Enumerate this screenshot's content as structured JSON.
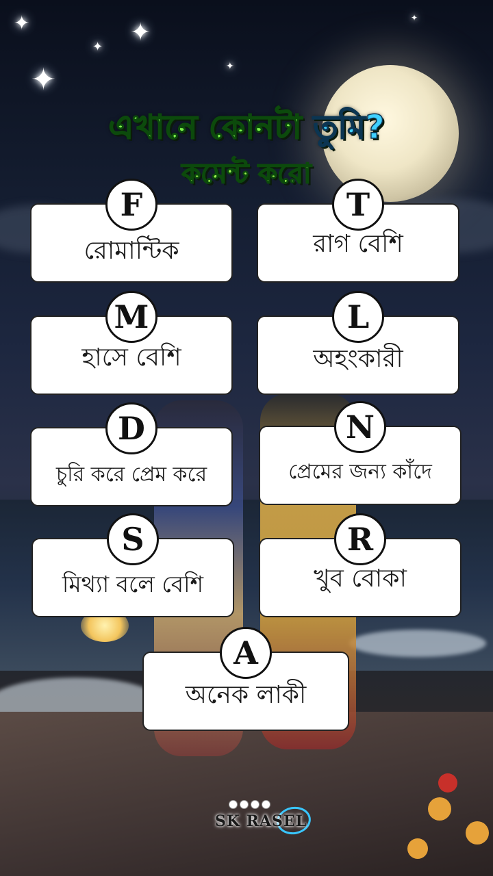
{
  "title": {
    "line1_part1": "এখানে কোনটা ",
    "line1_part2": "তুমি?",
    "line2": "কমেন্ট করো"
  },
  "options": [
    {
      "letter": "F",
      "label": "রোমান্টিক"
    },
    {
      "letter": "T",
      "label": "রাগ বেশি"
    },
    {
      "letter": "M",
      "label": "হাসে বেশি"
    },
    {
      "letter": "L",
      "label": "অহংকারী"
    },
    {
      "letter": "D",
      "label": "চুরি করে প্রেম করে"
    },
    {
      "letter": "N",
      "label": "প্রেমের জন্য কাঁদে"
    },
    {
      "letter": "S",
      "label": "মিথ্যা বলে বেশি"
    },
    {
      "letter": "R",
      "label": "খুব বোকা"
    },
    {
      "letter": "A",
      "label": "অনেক লাকী"
    }
  ],
  "watermark": {
    "text": "SK RASEL"
  },
  "colors": {
    "title_green": "#7df14a",
    "title_blue": "#3fd0ff",
    "card_bg": "#ffffff"
  }
}
